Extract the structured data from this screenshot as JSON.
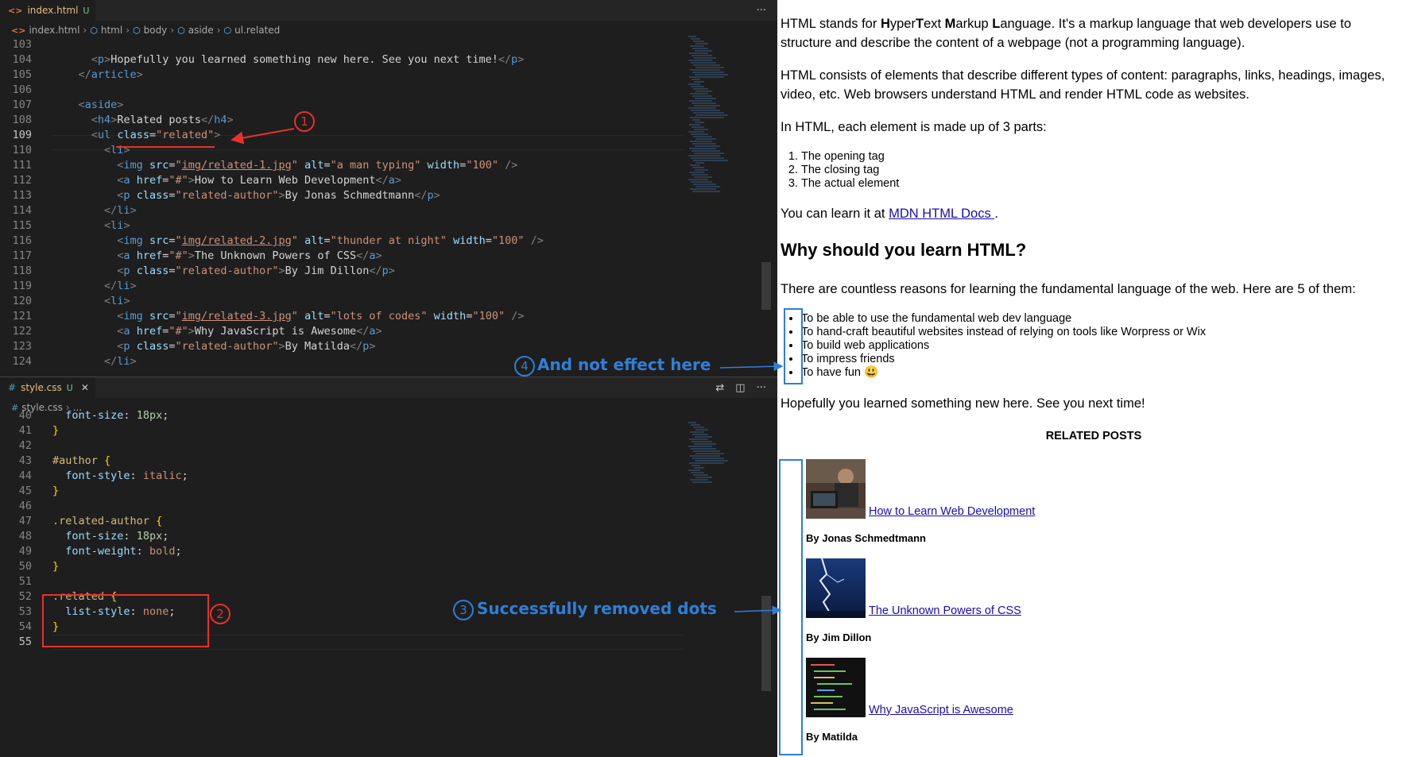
{
  "html_editor": {
    "tab": {
      "name": "index.html",
      "status": "U"
    },
    "breadcrumb": [
      "index.html",
      "html",
      "body",
      "aside",
      "ul.related"
    ],
    "more": "···",
    "lines": [
      {
        "n": "103",
        "html": ""
      },
      {
        "n": "104",
        "html": "      <span class='pun'>&lt;</span><span class='tag'>p</span><span class='pun'>&gt;</span><span class='tx'>Hopefully you learned something new here. See you next time!</span><span class='pun'>&lt;/</span><span class='tag'>p</span><span class='pun'>&gt;</span>"
      },
      {
        "n": "105",
        "html": "    <span class='pun'>&lt;/</span><span class='tag'>article</span><span class='pun'>&gt;</span>"
      },
      {
        "n": "106",
        "html": ""
      },
      {
        "n": "107",
        "html": "    <span class='pun'>&lt;</span><span class='tag'>aside</span><span class='pun'>&gt;</span>"
      },
      {
        "n": "108",
        "html": "      <span class='pun'>&lt;</span><span class='tag'>h4</span><span class='pun'>&gt;</span><span class='tx'>Related posts</span><span class='pun'>&lt;/</span><span class='tag'>h4</span><span class='pun'>&gt;</span>"
      },
      {
        "n": "109",
        "html": "      <span class='pun'>&lt;</span><span class='tag'>ul</span> <span class='attr'>class</span><span class='tx'>=</span><span class='str'>\"related\"</span><span class='pun'>&gt;</span>"
      },
      {
        "n": "110",
        "html": "        <span class='pun'>&lt;</span><span class='tag'>li</span><span class='pun'>&gt;</span>"
      },
      {
        "n": "111",
        "html": "          <span class='pun'>&lt;</span><span class='tag'>img</span> <span class='attr'>src</span><span class='tx'>=</span><span class='str'>\"<span class='ulink'>img/related-1.jpg</span>\"</span> <span class='attr'>alt</span><span class='tx'>=</span><span class='str'>\"a man typing\"</span> <span class='attr'>width</span><span class='tx'>=</span><span class='str'>\"100\"</span> <span class='pun'>/&gt;</span>"
      },
      {
        "n": "112",
        "html": "          <span class='pun'>&lt;</span><span class='tag'>a</span> <span class='attr'>href</span><span class='tx'>=</span><span class='str'>\"#\"</span><span class='pun'>&gt;</span><span class='tx'>How to Learn Web Development</span><span class='pun'>&lt;/</span><span class='tag'>a</span><span class='pun'>&gt;</span>"
      },
      {
        "n": "113",
        "html": "          <span class='pun'>&lt;</span><span class='tag'>p</span> <span class='attr'>class</span><span class='tx'>=</span><span class='str'>\"related-author\"</span><span class='pun'>&gt;</span><span class='tx'>By Jonas Schmedtmann</span><span class='pun'>&lt;/</span><span class='tag'>p</span><span class='pun'>&gt;</span>"
      },
      {
        "n": "114",
        "html": "        <span class='pun'>&lt;/</span><span class='tag'>li</span><span class='pun'>&gt;</span>"
      },
      {
        "n": "115",
        "html": "        <span class='pun'>&lt;</span><span class='tag'>li</span><span class='pun'>&gt;</span>"
      },
      {
        "n": "116",
        "html": "          <span class='pun'>&lt;</span><span class='tag'>img</span> <span class='attr'>src</span><span class='tx'>=</span><span class='str'>\"<span class='ulink'>img/related-2.jpg</span>\"</span> <span class='attr'>alt</span><span class='tx'>=</span><span class='str'>\"thunder at night\"</span> <span class='attr'>width</span><span class='tx'>=</span><span class='str'>\"100\"</span> <span class='pun'>/&gt;</span>"
      },
      {
        "n": "117",
        "html": "          <span class='pun'>&lt;</span><span class='tag'>a</span> <span class='attr'>href</span><span class='tx'>=</span><span class='str'>\"#\"</span><span class='pun'>&gt;</span><span class='tx'>The Unknown Powers of CSS</span><span class='pun'>&lt;/</span><span class='tag'>a</span><span class='pun'>&gt;</span>"
      },
      {
        "n": "118",
        "html": "          <span class='pun'>&lt;</span><span class='tag'>p</span> <span class='attr'>class</span><span class='tx'>=</span><span class='str'>\"related-author\"</span><span class='pun'>&gt;</span><span class='tx'>By Jim Dillon</span><span class='pun'>&lt;/</span><span class='tag'>p</span><span class='pun'>&gt;</span>"
      },
      {
        "n": "119",
        "html": "        <span class='pun'>&lt;/</span><span class='tag'>li</span><span class='pun'>&gt;</span>"
      },
      {
        "n": "120",
        "html": "        <span class='pun'>&lt;</span><span class='tag'>li</span><span class='pun'>&gt;</span>"
      },
      {
        "n": "121",
        "html": "          <span class='pun'>&lt;</span><span class='tag'>img</span> <span class='attr'>src</span><span class='tx'>=</span><span class='str'>\"<span class='ulink'>img/related-3.jpg</span>\"</span> <span class='attr'>alt</span><span class='tx'>=</span><span class='str'>\"lots of codes\"</span> <span class='attr'>width</span><span class='tx'>=</span><span class='str'>\"100\"</span> <span class='pun'>/&gt;</span>"
      },
      {
        "n": "122",
        "html": "          <span class='pun'>&lt;</span><span class='tag'>a</span> <span class='attr'>href</span><span class='tx'>=</span><span class='str'>\"#\"</span><span class='pun'>&gt;</span><span class='tx'>Why JavaScript is Awesome</span><span class='pun'>&lt;/</span><span class='tag'>a</span><span class='pun'>&gt;</span>"
      },
      {
        "n": "123",
        "html": "          <span class='pun'>&lt;</span><span class='tag'>p</span> <span class='attr'>class</span><span class='tx'>=</span><span class='str'>\"related-author\"</span><span class='pun'>&gt;</span><span class='tx'>By Matilda</span><span class='pun'>&lt;/</span><span class='tag'>p</span><span class='pun'>&gt;</span>"
      },
      {
        "n": "124",
        "html": "        <span class='pun'>&lt;/</span><span class='tag'>li</span><span class='pun'>&gt;</span>"
      }
    ]
  },
  "css_editor": {
    "tab": {
      "name": "style.css",
      "status": "U"
    },
    "breadcrumb": [
      "style.css",
      "..."
    ],
    "more": "···",
    "lines": [
      {
        "n": "40",
        "html": "  <span class='prop'>font-size</span><span class='tx'>: </span><span class='num'>18px</span><span class='tx'>;</span>"
      },
      {
        "n": "41",
        "html": "<span class='br'>}</span>"
      },
      {
        "n": "42",
        "html": ""
      },
      {
        "n": "43",
        "html": "<span class='sel'>#author</span> <span class='br'>{</span>"
      },
      {
        "n": "44",
        "html": "  <span class='prop'>font-style</span><span class='tx'>: </span><span class='val'>italic</span><span class='tx'>;</span>"
      },
      {
        "n": "45",
        "html": "<span class='br'>}</span>"
      },
      {
        "n": "46",
        "html": ""
      },
      {
        "n": "47",
        "html": "<span class='sel'>.related-author</span> <span class='br'>{</span>"
      },
      {
        "n": "48",
        "html": "  <span class='prop'>font-size</span><span class='tx'>: </span><span class='num'>18px</span><span class='tx'>;</span>"
      },
      {
        "n": "49",
        "html": "  <span class='prop'>font-weight</span><span class='tx'>: </span><span class='val'>bold</span><span class='tx'>;</span>"
      },
      {
        "n": "50",
        "html": "<span class='br'>}</span>"
      },
      {
        "n": "51",
        "html": ""
      },
      {
        "n": "52",
        "html": "<span class='sel'>.related</span> <span class='br'>{</span>"
      },
      {
        "n": "53",
        "html": "  <span class='prop'>list-style</span><span class='tx'>: </span><span class='val'>none</span><span class='tx'>;</span>"
      },
      {
        "n": "54",
        "html": "<span class='br'>}</span>"
      },
      {
        "n": "55",
        "html": ""
      }
    ]
  },
  "annotations": {
    "n1": "1",
    "n2": "2",
    "n3": "3",
    "n4": "4",
    "text3": "Successfully removed dots",
    "text4": "And not effect here"
  },
  "preview": {
    "p1_html": "HTML stands for <b>H</b>yper<b>T</b>ext <b>M</b>arkup <b>L</b>anguage. It's a markup language that web developers use to structure and describe the content of a webpage (not a programming language).",
    "p2": "HTML consists of elements that describe different types of content: paragraphs, links, headings, images, video, etc. Web browsers understand HTML and render HTML code as websites.",
    "p3": "In HTML, each element is made up of 3 parts:",
    "parts": [
      "The opening tag",
      "The closing tag",
      "The actual element"
    ],
    "learn_prefix": "You can learn it at ",
    "learn_link": "MDN HTML Docs ",
    "learn_suffix": ".",
    "h2": "Why should you learn HTML?",
    "p4": "There are countless reasons for learning the fundamental language of the web. Here are 5 of them:",
    "reasons": [
      "To be able to use the fundamental web dev language",
      "To hand-craft beautiful websites instead of relying on tools like Worpress or Wix",
      "To build web applications",
      "To impress friends",
      "To have fun 😃"
    ],
    "p5": "Hopefully you learned something new here. See you next time!",
    "related_title": "RELATED POSTS",
    "related": [
      {
        "title": "How to Learn Web Development",
        "author": "By Jonas Schmedtmann",
        "img": "a man typing"
      },
      {
        "title": "The Unknown Powers of CSS",
        "author": "By Jim Dillon",
        "img": "thunder at night"
      },
      {
        "title": "Why JavaScript is Awesome",
        "author": "By Matilda",
        "img": "lots of codes"
      }
    ],
    "colors": {
      "link": "#1a0dab",
      "annotation_red": "#e8312c",
      "annotation_blue": "#2f7fd8"
    }
  }
}
